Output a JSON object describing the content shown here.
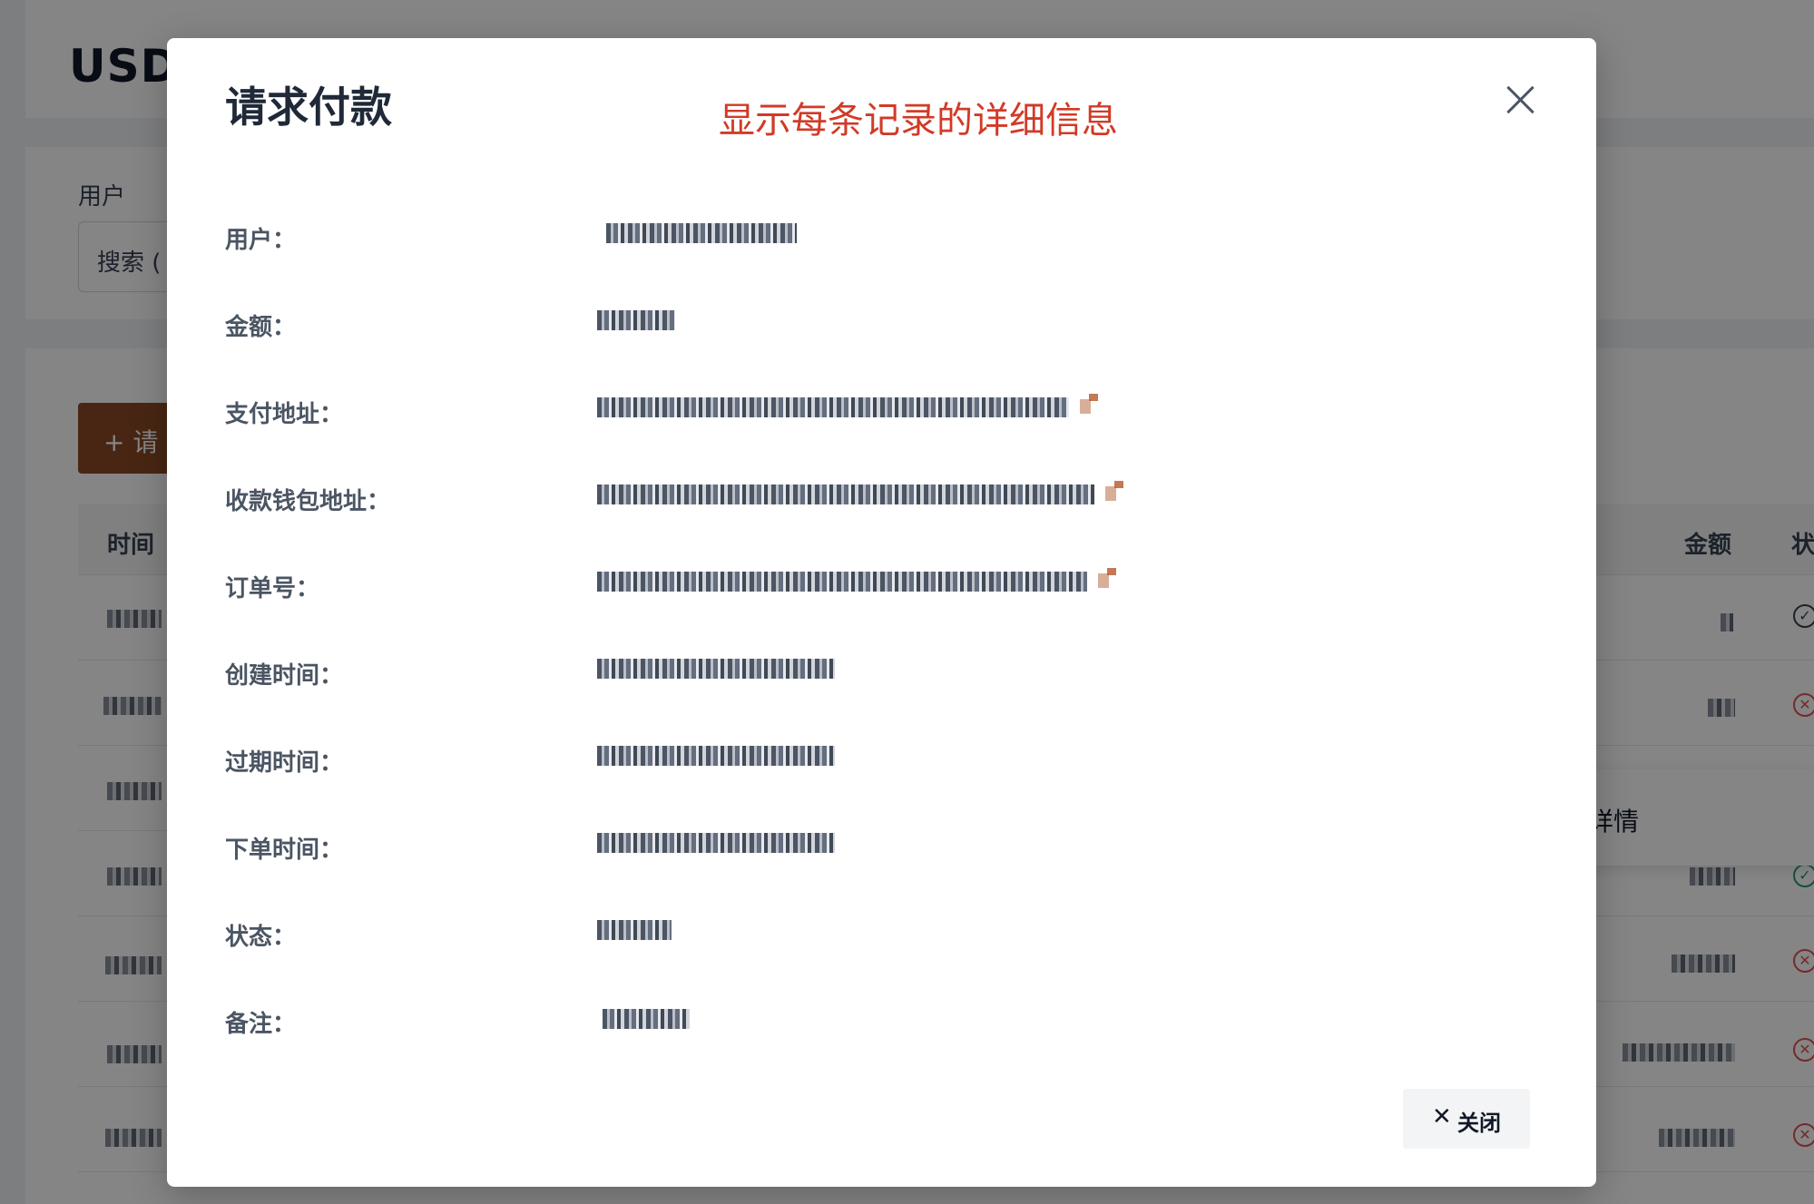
{
  "page": {
    "title": "USDT",
    "filter_label": "用户",
    "search_placeholder": "搜索 (",
    "add_button_label": "+ 请",
    "table_headers": {
      "time": "时间",
      "amount": "金额",
      "status": "状"
    },
    "popover_text": "详情",
    "rows": [
      {
        "status": "success"
      },
      {
        "status": "failed"
      },
      {
        "status": "unknown"
      },
      {
        "status": "success-green"
      },
      {
        "status": "failed"
      },
      {
        "status": "failed"
      },
      {
        "status": "failed"
      }
    ]
  },
  "modal": {
    "title": "请求付款",
    "annotation": "显示每条记录的详细信息",
    "fields": [
      {
        "label": "用户："
      },
      {
        "label": "金额："
      },
      {
        "label": "支付地址："
      },
      {
        "label": "收款钱包地址："
      },
      {
        "label": "订单号："
      },
      {
        "label": "创建时间："
      },
      {
        "label": "过期时间："
      },
      {
        "label": "下单时间："
      },
      {
        "label": "状态："
      },
      {
        "label": "备注："
      }
    ],
    "close_button_label": "关闭",
    "close_button_glyph": "✕"
  },
  "colors": {
    "annotation": "#d23a26",
    "brand_button": "#8b4a25",
    "success": "#22a06b",
    "error": "#e05252"
  },
  "icons": [
    "close-icon",
    "copy-icon",
    "check-circle-icon",
    "x-circle-icon",
    "plus-icon"
  ]
}
